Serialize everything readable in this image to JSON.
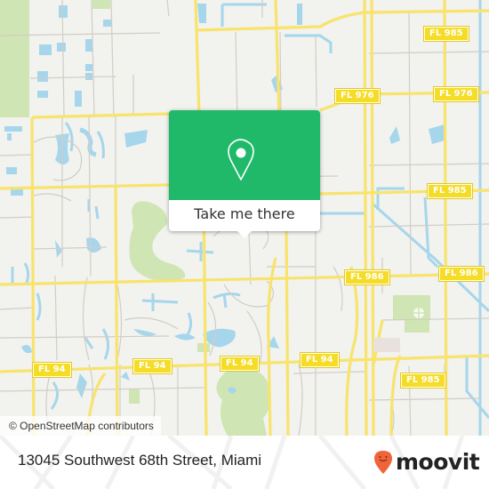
{
  "map": {
    "road_shields": [
      {
        "label": "FL 985",
        "id": "fl985-ne"
      },
      {
        "label": "FL 976",
        "id": "fl976-west"
      },
      {
        "label": "FL 976",
        "id": "fl976-east"
      },
      {
        "label": "FL 985",
        "id": "fl985-east"
      },
      {
        "label": "FL 986",
        "id": "fl986-west"
      },
      {
        "label": "FL 986",
        "id": "fl986-east"
      },
      {
        "label": "FL 94",
        "id": "fl94-1"
      },
      {
        "label": "FL 94",
        "id": "fl94-2"
      },
      {
        "label": "FL 94",
        "id": "fl94-3"
      },
      {
        "label": "FL 94",
        "id": "fl94-4"
      },
      {
        "label": "FL 985",
        "id": "fl985-se"
      }
    ],
    "attribution": "© OpenStreetMap contributors",
    "colors": {
      "background": "#f2f2ee",
      "major_road": "#f8e36c",
      "minor_road": "#cfcac4",
      "water": "#a6d6ec",
      "park": "#cfe5b3"
    }
  },
  "popup": {
    "icon": "map-pin-icon",
    "button_label": "Take me there",
    "accent_color": "#20b96a"
  },
  "footer": {
    "address": "13045 Southwest 68th Street, Miami",
    "brand": "moovit",
    "brand_color": "#f0643a"
  }
}
